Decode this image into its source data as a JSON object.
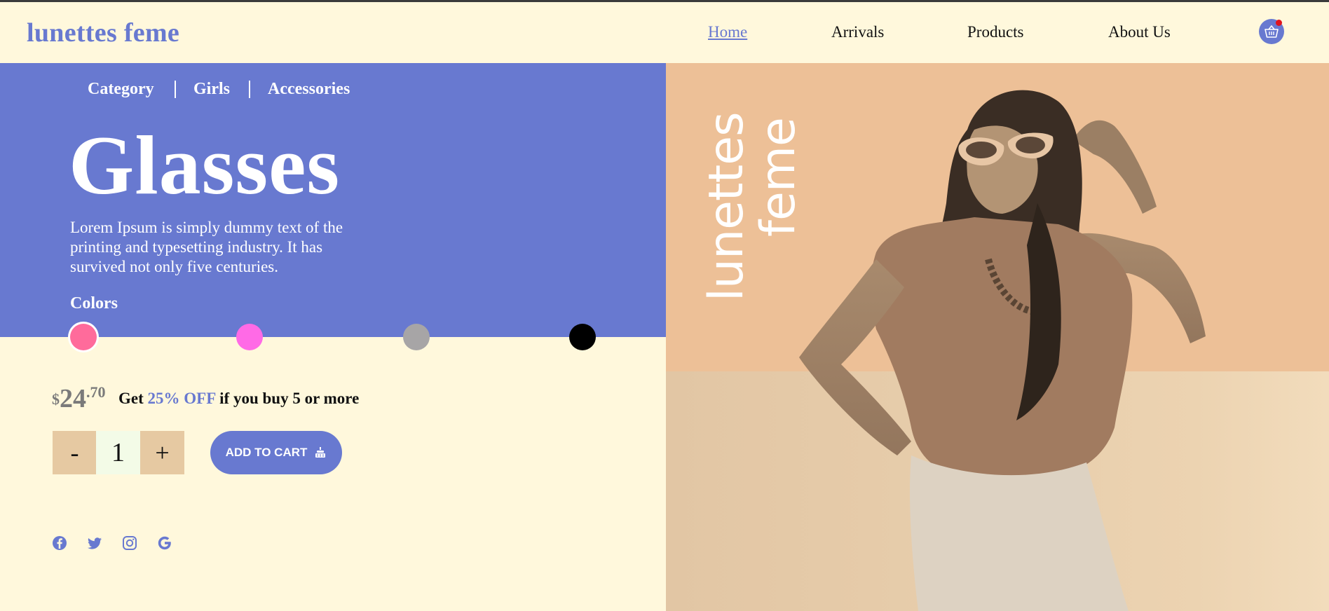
{
  "header": {
    "brand": "lunettes feme",
    "nav": [
      {
        "label": "Home",
        "active": true
      },
      {
        "label": "Arrivals",
        "active": false
      },
      {
        "label": "Products",
        "active": false
      },
      {
        "label": "About Us",
        "active": false
      }
    ],
    "cart_icon": "basket-icon"
  },
  "breadcrumb": [
    "Category",
    "Girls",
    "Accessories"
  ],
  "product": {
    "title": "Glasses",
    "description": "Lorem Ipsum is simply dummy text of the printing and typesetting industry. It has survived not only five centuries.",
    "colors_label": "Colors",
    "swatches": [
      "#ff6b9b",
      "#ff6ae6",
      "#a7a5a6",
      "#000000"
    ],
    "selected_swatch": 0
  },
  "pricing": {
    "currency": "$",
    "whole": "24",
    "cents": ".70",
    "offer_prefix": "Get",
    "offer_highlight": "25% OFF",
    "offer_suffix": "if you buy 5 or more"
  },
  "quantity": {
    "minus": "-",
    "value": "1",
    "plus": "+"
  },
  "cart": {
    "label": "ADD TO CART",
    "icon": "cart-icon"
  },
  "social": [
    "facebook-icon",
    "twitter-icon",
    "instagram-icon",
    "google-icon"
  ],
  "hero_image": {
    "brand_line1": "lunettes",
    "brand_line2": "feme"
  },
  "colors": {
    "accent": "#6879d0",
    "background": "#fff8dc",
    "qty_button": "#e6c9a2",
    "photo_tone": "#efc197"
  }
}
